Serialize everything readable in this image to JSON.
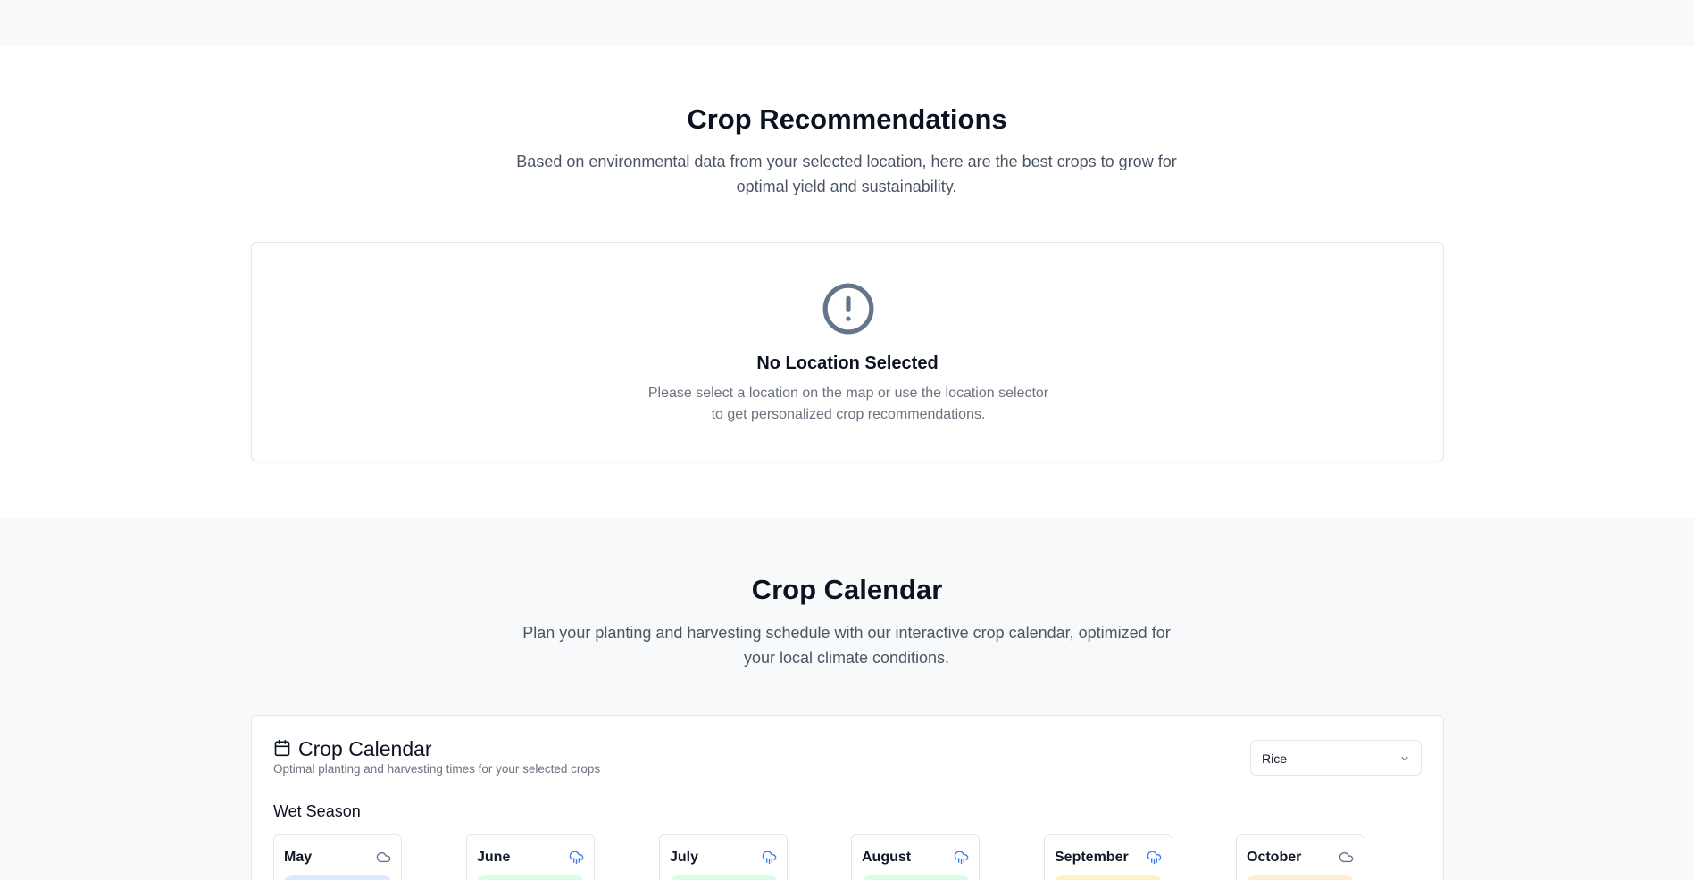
{
  "recommendations": {
    "title": "Crop Recommendations",
    "subtitle": "Based on environmental data from your selected location, here are the best crops to grow for optimal yield and sustainability.",
    "empty_state": {
      "icon": "alert-circle-icon",
      "title": "No Location Selected",
      "message": "Please select a location on the map or use the location selector to get personalized crop recommendations."
    }
  },
  "calendar_section": {
    "title": "Crop Calendar",
    "subtitle": "Plan your planting and harvesting schedule with our interactive crop calendar, optimized for your local climate conditions."
  },
  "calendar_card": {
    "title": "Crop Calendar",
    "subtitle": "Optimal planting and harvesting times for your selected crops",
    "icon": "calendar-icon",
    "crop_select": {
      "value": "Rice",
      "icon": "chevron-down-icon"
    },
    "season": "Wet Season",
    "months": [
      {
        "name": "May",
        "weather_icon": "cloud-icon",
        "pill_color": "#dbeafe"
      },
      {
        "name": "June",
        "weather_icon": "cloud-rain-icon",
        "pill_color": "#dcfce7"
      },
      {
        "name": "July",
        "weather_icon": "cloud-rain-icon",
        "pill_color": "#dcfce7"
      },
      {
        "name": "August",
        "weather_icon": "cloud-rain-icon",
        "pill_color": "#dcfce7"
      },
      {
        "name": "September",
        "weather_icon": "cloud-rain-icon",
        "pill_color": "#fef3c7"
      },
      {
        "name": "October",
        "weather_icon": "cloud-icon",
        "pill_color": "#ffedd5"
      }
    ]
  },
  "colors": {
    "page_bg": "#f8f9fb",
    "card_border": "#e5e7eb",
    "icon_slate": "#64748b",
    "rain_blue": "#3b82f6"
  }
}
